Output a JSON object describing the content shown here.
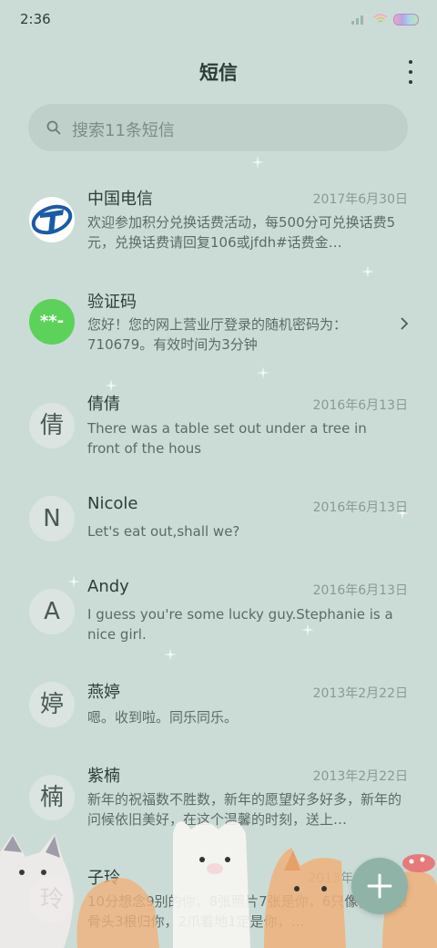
{
  "status_bar": {
    "time": "2:36"
  },
  "header": {
    "title": "短信"
  },
  "search": {
    "placeholder": "搜索11条短信"
  },
  "messages": [
    {
      "name": "中国电信",
      "date": "2017年6月30日",
      "preview": "欢迎参加积分兑换话费活动，每500分可兑换话费5元，兑换话费请回复106或jfdh#话费金…",
      "avatar": "telecom-logo"
    },
    {
      "name": "验证码",
      "date": "",
      "preview": "您好！您的网上营业厅登录的随机密码为：710679。有效时间为3分钟",
      "avatar_text": "**-"
    },
    {
      "name": "倩倩",
      "date": "2016年6月13日",
      "preview": "There was a table set out under a tree in front of the hous",
      "avatar_text": "倩"
    },
    {
      "name": "Nicole",
      "date": "2016年6月13日",
      "preview": "Let's eat out,shall we?",
      "avatar_text": "N"
    },
    {
      "name": "Andy",
      "date": "2016年6月13日",
      "preview": "I guess you're some lucky guy.Stephanie is a nice girl.",
      "avatar_text": "A"
    },
    {
      "name": "燕婷",
      "date": "2013年2月22日",
      "preview": "嗯。收到啦。同乐同乐。",
      "avatar_text": "婷"
    },
    {
      "name": "紫楠",
      "date": "2013年2月22日",
      "preview": "新年的祝福数不胜数，新年的愿望好多好多，新年的问候依旧美好，在这个温馨的时刻，送上…",
      "avatar_text": "楠"
    },
    {
      "name": "子玲",
      "date": "2013年",
      "preview": "10分想念9别的你，8张照片7张是你，6只像你，4根骨头3根归你，2爪着地1定是你，…",
      "avatar_text": "玲"
    }
  ],
  "colors": {
    "background": "#cbdcd6",
    "accent": "#8fb3a6",
    "telecom_blue": "#1a5ba6",
    "verify_green": "#5cd25a"
  },
  "icons": {
    "menu": "more-vertical-icon",
    "search": "search-icon",
    "compose": "plus-icon",
    "open": "chevron-right-icon"
  }
}
